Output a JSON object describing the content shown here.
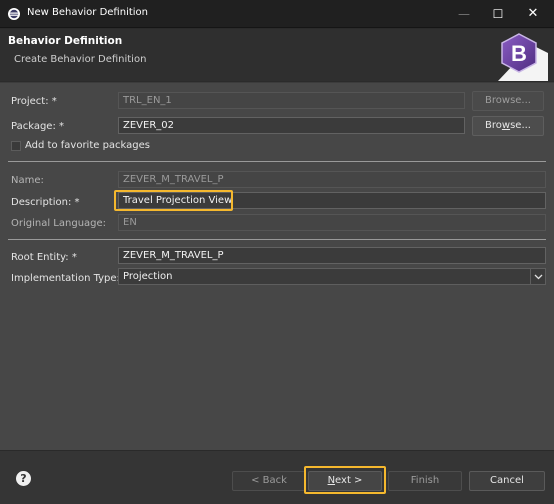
{
  "window": {
    "title": "New Behavior Definition",
    "icon": "eclipse-icon",
    "minimize_glyph": "—",
    "maximize_glyph": "☐",
    "close_glyph": "✕"
  },
  "banner": {
    "title": "Behavior Definition",
    "subtitle": "Create Behavior Definition",
    "logo_letter": "B"
  },
  "form": {
    "project": {
      "label": "Project: *",
      "value": "TRL_EN_1",
      "browse": "Browse..."
    },
    "package": {
      "label": "Package: *",
      "value": "ZEVER_02",
      "browse_pre": "Bro",
      "browse_ul": "w",
      "browse_post": "se..."
    },
    "favorite": {
      "label": "Add to favorite packages",
      "checked": false
    },
    "name": {
      "label": "Name:",
      "value": "ZEVER_M_TRAVEL_P"
    },
    "description": {
      "label": "Description: *",
      "value": "Travel Projection View"
    },
    "original_language": {
      "label": "Original Language:",
      "value": "EN"
    },
    "root_entity": {
      "label": "Root Entity: *",
      "value": "ZEVER_M_TRAVEL_P"
    },
    "implementation_type": {
      "label": "Implementation Type: *",
      "value": "Projection"
    }
  },
  "footer": {
    "help_glyph": "?",
    "back": "< Back",
    "next_ul": "N",
    "next_rest": "ext >",
    "finish": "Finish",
    "cancel": "Cancel"
  },
  "colors": {
    "highlight": "#f5b82e",
    "logo_purple": "#6a3fa0"
  }
}
